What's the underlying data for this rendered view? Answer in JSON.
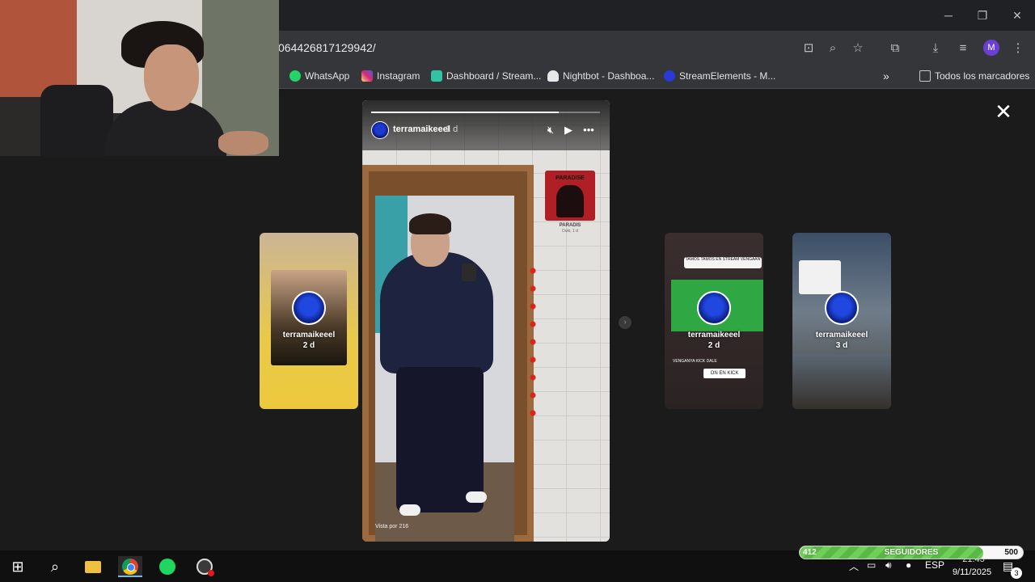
{
  "browser": {
    "url": "064426817129942/",
    "window_controls": [
      "minimize-icon",
      "restore-icon",
      "close-icon"
    ],
    "toolbar_icons": [
      "install-app-icon",
      "zoom-icon",
      "star-icon",
      "extensions-icon",
      "download-icon",
      "media-control-icon",
      "more-icon"
    ],
    "profile_initial": "M",
    "bookmarks": [
      {
        "label": "WhatsApp",
        "icon": "whatsapp-icon",
        "color": "#25d366"
      },
      {
        "label": "Instagram",
        "icon": "instagram-icon",
        "color": "#d62976"
      },
      {
        "label": "Dashboard / Stream...",
        "icon": "streamlabs-icon",
        "color": "#31c3a2"
      },
      {
        "label": "Nightbot - Dashboa...",
        "icon": "nightbot-icon",
        "color": "#e8e8e8"
      },
      {
        "label": "StreamElements - M...",
        "icon": "streamelements-icon",
        "color": "#2b39d6"
      }
    ],
    "bookmarks_overflow": "»",
    "all_bookmarks_label": "Todos los marcadores"
  },
  "story_viewer": {
    "close_icon": "close-icon",
    "progress": 0.82,
    "current": {
      "username": "terramaikeeel",
      "time": "1 d",
      "music_sticker_title": "PARADISE",
      "music_artist": "PARADIS",
      "music_sub": "Duki, 1 d",
      "views_text": "Vista por 216"
    },
    "previews": [
      {
        "username": "terramaikeeel",
        "time": "2 d"
      },
      {
        "username": "terramaikeeel",
        "time": "2 d",
        "sticker_top": "TAMOS TAMOS EN STREAM VENGAAN",
        "caption": "VENGANYA KICK DALE",
        "kick_label": "ON EN KICK"
      },
      {
        "username": "terramaikeeel",
        "time": "3 d"
      }
    ]
  },
  "followers_goal": {
    "current": "412",
    "label": "SEGUIDORES",
    "target": "500",
    "fraction": 0.824
  },
  "taskbar": {
    "apps": [
      "windows-start-icon",
      "search-icon",
      "file-explorer-icon",
      "chrome-icon",
      "spotify-icon",
      "obs-icon"
    ],
    "language": "ESP",
    "time": "21:45",
    "date": "9/11/2025",
    "notification_count": "3"
  }
}
